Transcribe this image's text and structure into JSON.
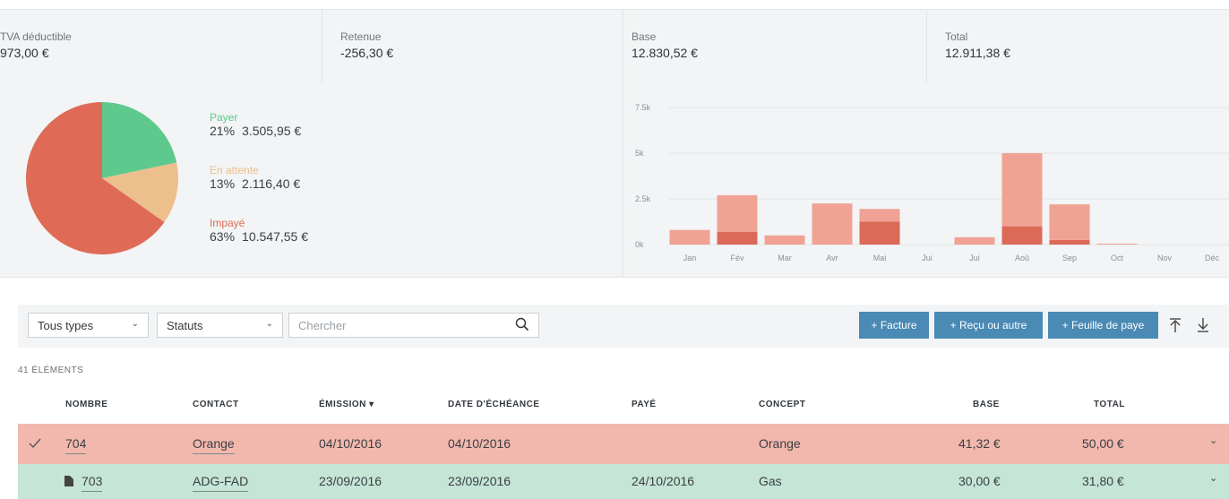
{
  "kpis": {
    "tva": {
      "label": "TVA déductible",
      "value": "973,00 €"
    },
    "retenue": {
      "label": "Retenue",
      "value": "-256,30 €"
    },
    "base": {
      "label": "Base",
      "value": "12.830,52 €"
    },
    "total": {
      "label": "Total",
      "value": "12.911,38 €"
    }
  },
  "pie": {
    "slices": [
      {
        "name": "Payer",
        "pct": "21%",
        "amount": "3.505,95 €",
        "color": "#5ec98d"
      },
      {
        "name": "En attente",
        "pct": "13%",
        "amount": "2.116,40 €",
        "color": "#ecbf8d"
      },
      {
        "name": "Impayé",
        "pct": "63%",
        "amount": "10.547,55 €",
        "color": "#df6b57"
      }
    ]
  },
  "chart_data": {
    "type": "bar",
    "categories": [
      "Jan",
      "Fév",
      "Mar",
      "Avr",
      "Mai",
      "Jui",
      "Jui",
      "Aoû",
      "Sep",
      "Oct",
      "Nov",
      "Déc"
    ],
    "series": [
      {
        "values": [
          800,
          2000,
          500,
          2250,
          700,
          0,
          400,
          4000,
          1950,
          50,
          0,
          0
        ],
        "color": "#f0a294"
      },
      {
        "values": [
          0,
          700,
          0,
          0,
          1250,
          0,
          0,
          1000,
          250,
          0,
          0,
          0
        ],
        "color": "#dc6a58"
      }
    ],
    "yticks": [
      "0k",
      "2.5k",
      "5k",
      "7.5k"
    ],
    "ylim": [
      0,
      7500
    ],
    "stacked": true
  },
  "toolbar": {
    "type_select": "Tous types",
    "status_select": "Statuts",
    "search_placeholder": "Chercher",
    "btn_facture": "+ Facture",
    "btn_recu": "+ Reçu ou autre",
    "btn_feuille": "+ Feuille de paye"
  },
  "table": {
    "count": "41 ÉLÉMENTS",
    "headers": {
      "nombre": "NOMBRE",
      "contact": "CONTACT",
      "emission": "ÉMISSION ▾",
      "echeance": "DATE D'ÉCHÉANCE",
      "paye": "PAYÉ",
      "concept": "CONCEPT",
      "base": "BASE",
      "total": "TOTAL"
    },
    "rows": [
      {
        "nombre": "704",
        "contact": "Orange",
        "emission": "04/10/2016",
        "echeance": "04/10/2016",
        "paye": "",
        "concept": "Orange",
        "base": "41,32 €",
        "total": "50,00 €"
      },
      {
        "nombre": "703",
        "contact": "ADG-FAD",
        "emission": "23/09/2016",
        "echeance": "23/09/2016",
        "paye": "24/10/2016",
        "concept": "Gas",
        "base": "30,00 €",
        "total": "31,80 €"
      }
    ]
  }
}
